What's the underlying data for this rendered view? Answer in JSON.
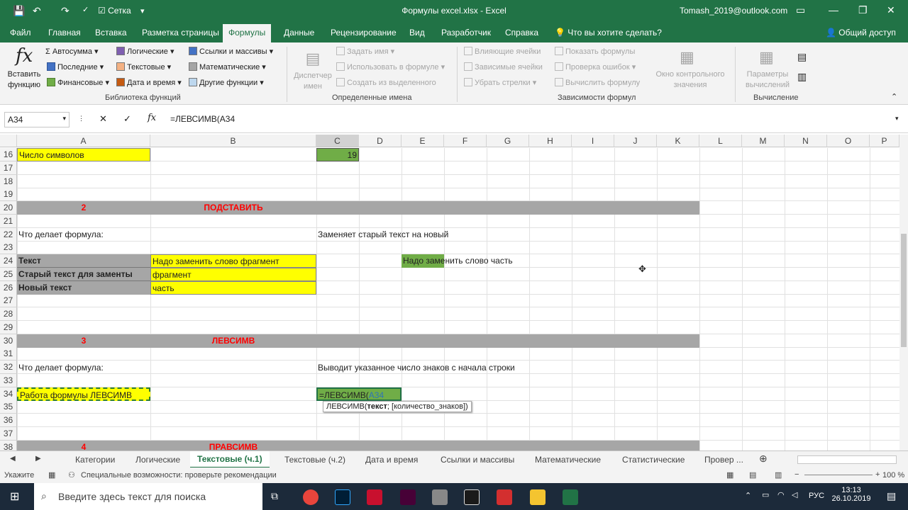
{
  "titlebar": {
    "autosave": "Сетка",
    "title": "Формулы excel.xlsx  -  Excel",
    "account": "Tomash_2019@outlook.com"
  },
  "tabs": [
    "Файл",
    "Главная",
    "Вставка",
    "Разметка страницы",
    "Формулы",
    "Данные",
    "Рецензирование",
    "Вид",
    "Разработчик",
    "Справка",
    "Что вы хотите сделать?",
    "Общий доступ"
  ],
  "ribbon": {
    "insert_fn": "Вставить функцию",
    "library": {
      "autosum": "Автосумма",
      "recent": "Последние",
      "financial": "Финансовые",
      "logical": "Логические",
      "text": "Текстовые",
      "datetime": "Дата и время",
      "lookup": "Ссылки и массивы",
      "math": "Математические",
      "other": "Другие функции",
      "label": "Библиотека функций"
    },
    "names": {
      "manager": "Диспетчер имен",
      "define": "Задать имя",
      "use": "Использовать в формуле",
      "create": "Создать из выделенного",
      "label": "Определенные имена"
    },
    "audit": {
      "precedents": "Влияющие ячейки",
      "dependents": "Зависимые ячейки",
      "remove": "Убрать стрелки",
      "show": "Показать формулы",
      "check": "Проверка ошибок",
      "evaluate": "Вычислить формулу",
      "watch": "Окно контрольного значения",
      "label": "Зависимости формул"
    },
    "calc": {
      "options": "Параметры вычислений",
      "label": "Вычисление"
    }
  },
  "formula_bar": {
    "name": "A34",
    "formula": "=ЛЕВСИМВ(A34"
  },
  "columns": [
    "A",
    "B",
    "C",
    "D",
    "E",
    "F",
    "G",
    "H",
    "I",
    "J",
    "K",
    "L",
    "M",
    "N",
    "O",
    "P"
  ],
  "rows": [
    "16",
    "17",
    "18",
    "19",
    "20",
    "21",
    "22",
    "23",
    "24",
    "25",
    "26",
    "27",
    "28",
    "29",
    "30",
    "31",
    "32",
    "33",
    "34",
    "35",
    "36",
    "37",
    "38"
  ],
  "cells": {
    "a16": "Число символов",
    "c16": "19",
    "a20": "2",
    "b20": "ПОДСТАВИТЬ",
    "a22": "Что делает формула:",
    "c22": "Заменяет старый текст на новый",
    "a24": "Текст",
    "b24": "Надо заменить слово фрагмент",
    "e24": "Надо заменить слово часть",
    "a25": "Старый текст для заменты",
    "b25": "фрагмент",
    "a26": "Новый текст",
    "b26": "часть",
    "a30": "3",
    "b30": "ЛЕВСИМВ",
    "a32": "Что делает формула:",
    "c32": "Выводит указанное число знаков с начала строки",
    "a34": "Работа формулы ЛЕВСИМВ",
    "c34_a": "=ЛЕВСИМВ(",
    "c34_b": "A34",
    "a38": "4",
    "b38": "ПРАВСИМВ"
  },
  "tooltip": {
    "fn": "ЛЕВСИМВ(",
    "arg1": "текст",
    "rest": "; [количество_знаков])"
  },
  "sheettabs": [
    "Категории",
    "Логические",
    "Текстовые (ч.1)",
    "Текстовые (ч.2)",
    "Дата и время",
    "Ссылки и массивы",
    "Математические",
    "Статистические",
    "Провер ..."
  ],
  "status": {
    "mode": "Укажите",
    "accessibility": "Специальные возможности: проверьте рекомендации",
    "zoom": "100 %"
  },
  "taskbar": {
    "search": "Введите здесь текст для поиска",
    "lang": "РУС",
    "time": "13:13",
    "date": "26.10.2019"
  }
}
